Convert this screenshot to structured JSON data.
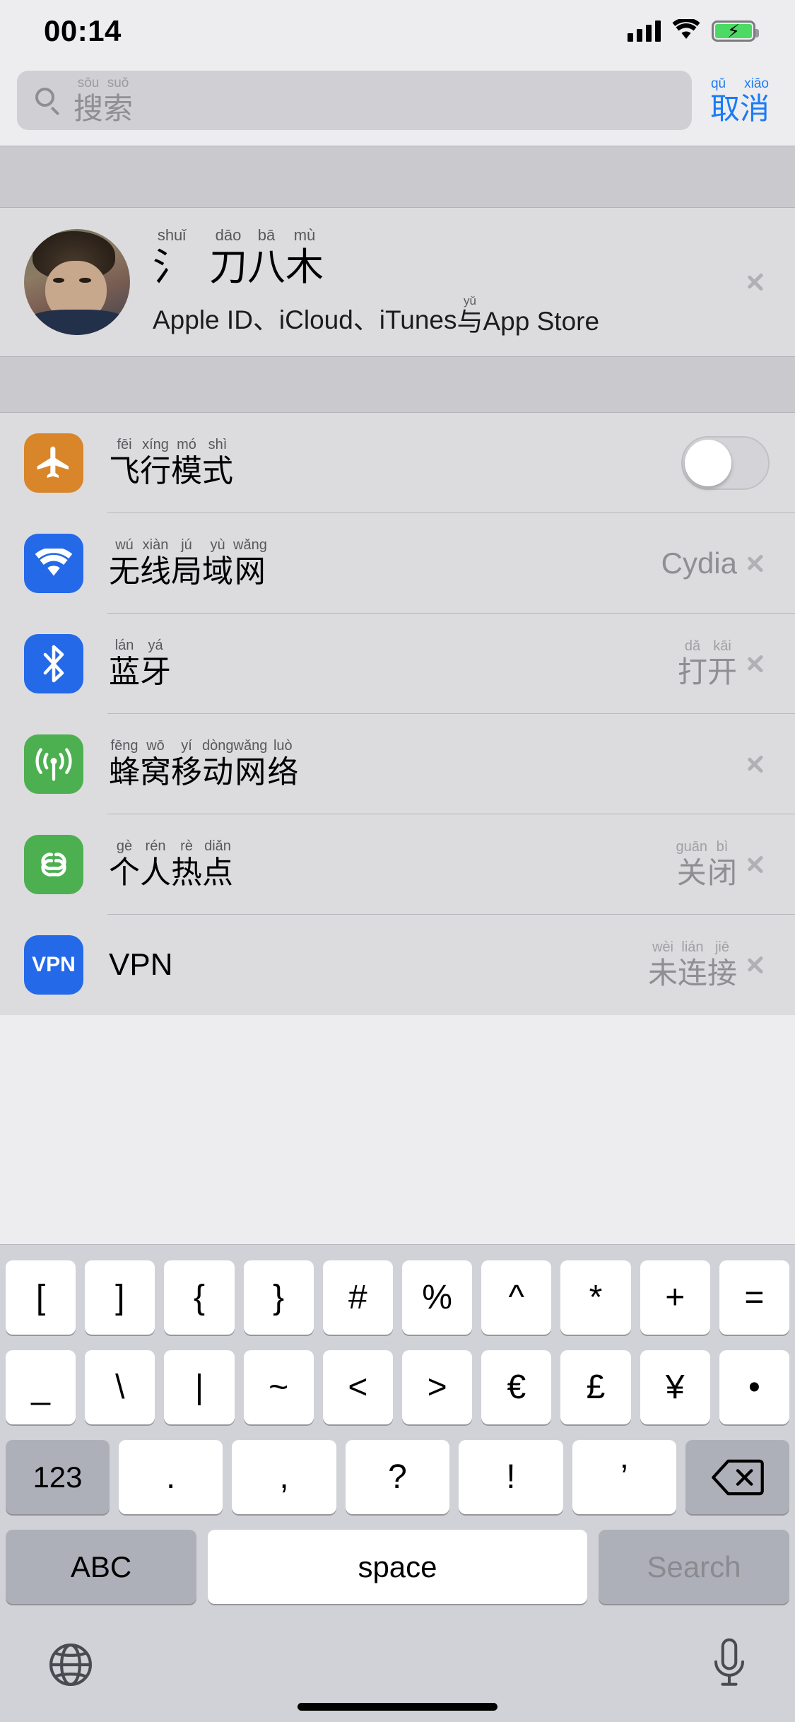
{
  "status_bar": {
    "time": "00:14",
    "signal_icon": "cellular-bars-icon",
    "wifi_icon": "wifi-icon",
    "battery_icon": "battery-charging-icon"
  },
  "search": {
    "icon": "search-icon",
    "placeholder_pinyin": [
      "sōu",
      "suǒ"
    ],
    "placeholder_hanzi": [
      "搜",
      "索"
    ],
    "cancel_pinyin": [
      "qǔ",
      "xiāo"
    ],
    "cancel_hanzi": [
      "取",
      "消"
    ],
    "cancel_color": "#1b7bf5"
  },
  "profile": {
    "avatar": "user-avatar",
    "name_pinyin": [
      "shuǐ",
      "dāo",
      "bā",
      "mù"
    ],
    "name_hanzi": [
      "氵",
      "刀",
      "八",
      "木"
    ],
    "subtitle_pre": "Apple ID、iCloud、iTunes ",
    "subtitle_ruby_pinyin": "yǔ",
    "subtitle_ruby_hanzi": "与",
    "subtitle_post": " App Store",
    "chevron": "chevron-right-icon"
  },
  "settings_rows": [
    {
      "icon": "airplane-icon",
      "icon_color": "#d98529",
      "pinyin": [
        "fēi",
        "xíng",
        "mó",
        "shì"
      ],
      "hanzi": [
        "飞",
        "行",
        "模",
        "式"
      ],
      "control": "toggle",
      "toggle_on": false
    },
    {
      "icon": "wifi-icon",
      "icon_color": "#2469e8",
      "pinyin": [
        "wú",
        "xiàn",
        "jú",
        "yù",
        "wǎng"
      ],
      "hanzi": [
        "无",
        "线",
        "局",
        "域",
        "网"
      ],
      "control": "chevron",
      "value_plain": "Cydia"
    },
    {
      "icon": "bluetooth-icon",
      "icon_color": "#2469e8",
      "pinyin": [
        "lán",
        "yá"
      ],
      "hanzi": [
        "蓝",
        "牙"
      ],
      "control": "chevron",
      "value_pinyin": [
        "dǎ",
        "kāi"
      ],
      "value_hanzi": [
        "打",
        "开"
      ]
    },
    {
      "icon": "cellular-antenna-icon",
      "icon_color": "#4cb050",
      "pinyin": [
        "fēng",
        "wō",
        "yí",
        "dòng",
        "wǎng",
        "luò"
      ],
      "hanzi": [
        "蜂",
        "窝",
        "移",
        "动",
        "网",
        "络"
      ],
      "control": "chevron"
    },
    {
      "icon": "hotspot-icon",
      "icon_color": "#4cb050",
      "pinyin": [
        "gè",
        "rén",
        "rè",
        "diǎn"
      ],
      "hanzi": [
        "个",
        "人",
        "热",
        "点"
      ],
      "control": "chevron",
      "value_pinyin": [
        "guān",
        "bì"
      ],
      "value_hanzi": [
        "关",
        "闭"
      ]
    },
    {
      "icon": "vpn-icon",
      "icon_color": "#2469e8",
      "icon_text": "VPN",
      "label_plain": "VPN",
      "control": "chevron",
      "value_pinyin": [
        "wèi",
        "lián",
        "jiē"
      ],
      "value_hanzi": [
        "未",
        "连",
        "接"
      ]
    }
  ],
  "keyboard": {
    "row1": [
      "[",
      "]",
      "{",
      "}",
      "#",
      "%",
      "^",
      "*",
      "+",
      "="
    ],
    "row2": [
      "_",
      "\\",
      "|",
      "~",
      "<",
      ">",
      "€",
      "£",
      "¥",
      "•"
    ],
    "row3_left": "123",
    "row3_keys": [
      ".",
      ",",
      "?",
      "!",
      "’"
    ],
    "row3_delete_icon": "backspace-icon",
    "row4_abc": "ABC",
    "row4_space": "space",
    "row4_search": "Search",
    "globe_icon": "globe-icon",
    "mic_icon": "microphone-icon"
  }
}
